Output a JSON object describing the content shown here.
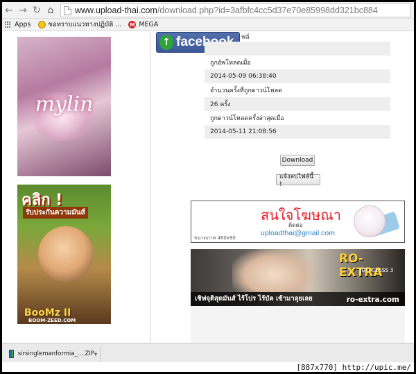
{
  "browser": {
    "url_host": "www.upload-thai.com",
    "url_path": "/download.php?id=3afbfc4cc5d37e70e85998dd321bc884",
    "bookmarks": [
      {
        "label": "Apps"
      },
      {
        "label": "ขอทราบแนวทางปฏิบัติ ..."
      },
      {
        "label": "MEGA"
      }
    ]
  },
  "page": {
    "facebook_label": "facebook",
    "partial_label": "ฟล์",
    "info": [
      {
        "label": "ถูกอัพโหลดเมื่อ",
        "value": "2014-05-09 06:38:40"
      },
      {
        "label": "จำนวนครั้งที่ถูกดาวน์โหลด",
        "value": "26 ครั้ง"
      },
      {
        "label": "ถูกดาวน์โหลดครั้งล่าสุดเมื่อ",
        "value": "2014-05-11 21:08:56"
      }
    ],
    "download_button": "Download",
    "report_button": "แจ้งลบไฟล์นี้ !"
  },
  "ads": {
    "left_top": {
      "logo": "mylin"
    },
    "left_bottom": {
      "click": "คลิก !",
      "tag": "รับประกันความมันส์",
      "brand": "BooMz II",
      "site": "BOOM-ZEED.COM"
    },
    "banner": {
      "headline": "สนใจโฆษณา",
      "sub": "ติดต่อ",
      "email": "uploadthai@gmail.com",
      "size": "ขนาดภาพ 460x90"
    },
    "ro": {
      "title": "RO-EXTRA",
      "class": "JUTI CLASS 3",
      "slogan": "เชิฟจุติสุดมันส์ ไร้โปร ไร้บัค เข้ามาลุยเลย",
      "domain": "ro-extra.com"
    }
  },
  "download_shelf": {
    "file": "sirsinglemanformia_....ZIP"
  },
  "stamp": "[887x770] http://upic.me/"
}
